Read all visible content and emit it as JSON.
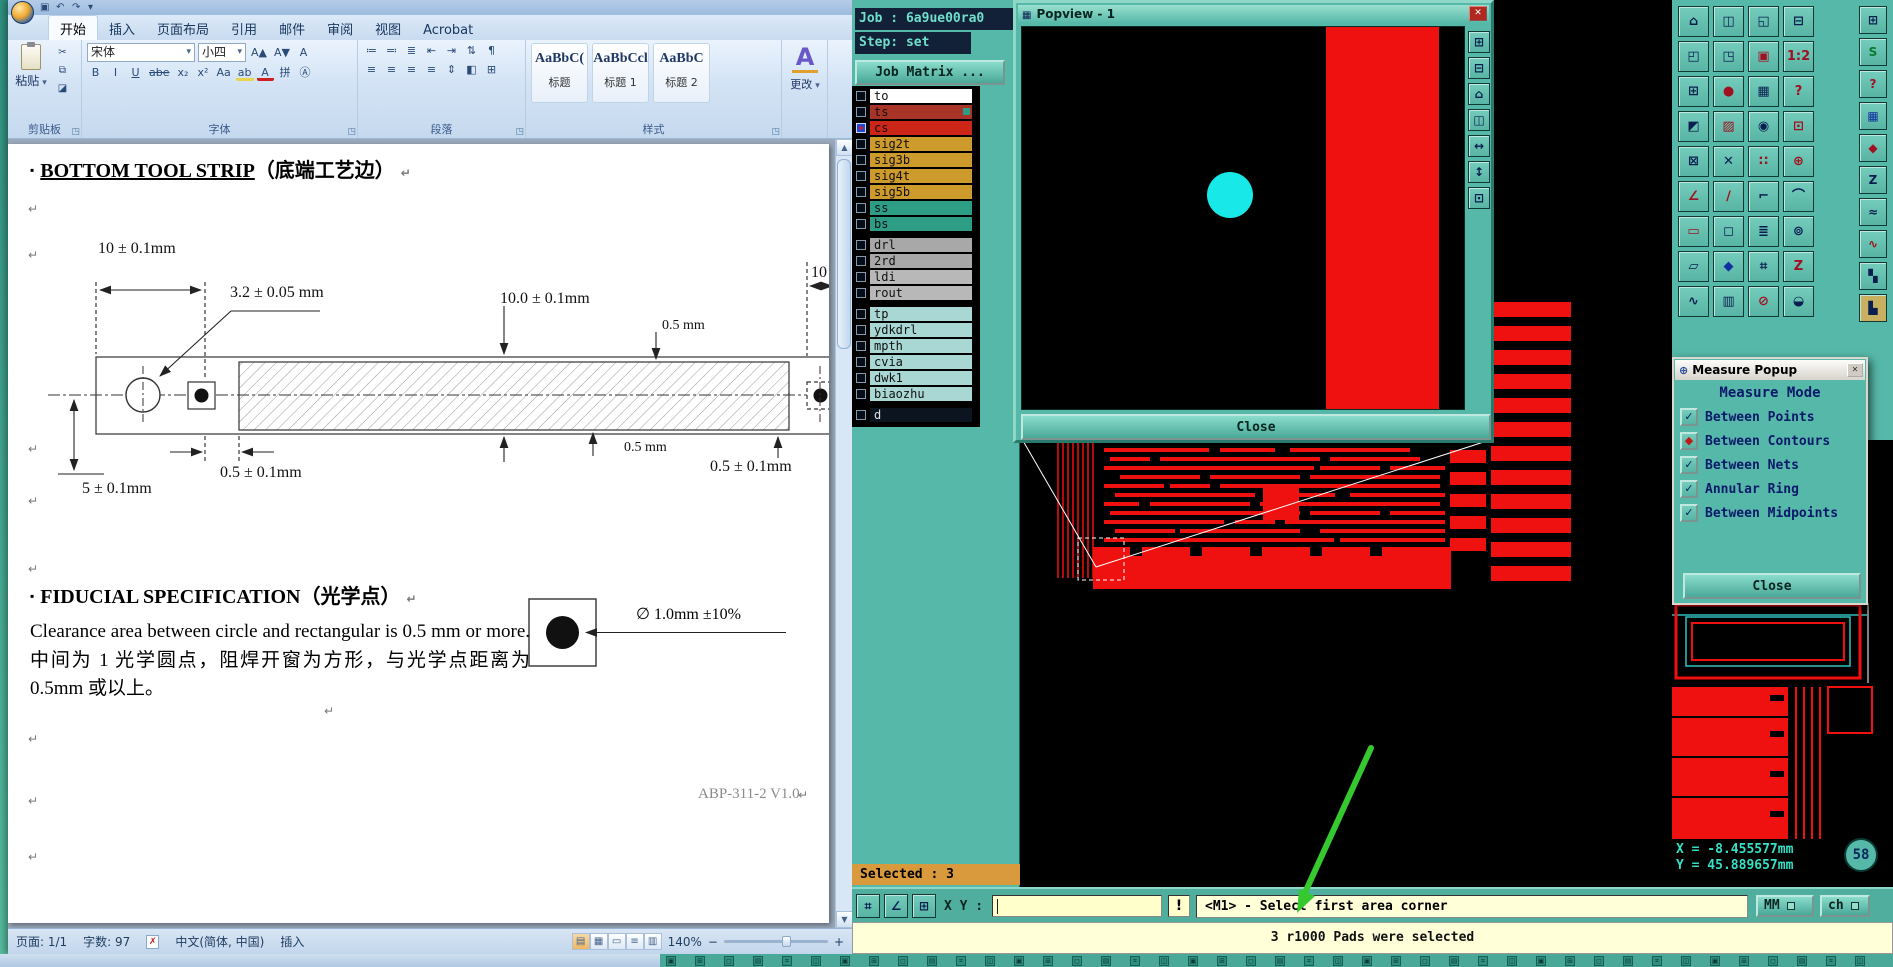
{
  "word": {
    "qat": {
      "save": "▣",
      "undo": "↶",
      "redo": "↷",
      "more": "▾"
    },
    "tabs": [
      {
        "label": "开始",
        "active": true
      },
      {
        "label": "插入"
      },
      {
        "label": "页面布局"
      },
      {
        "label": "引用"
      },
      {
        "label": "邮件"
      },
      {
        "label": "审阅"
      },
      {
        "label": "视图"
      },
      {
        "label": "Acrobat"
      }
    ],
    "ribbon": {
      "paste_label": "粘贴",
      "clip_buttons": [
        {
          "g": "✂"
        },
        {
          "g": "⧉"
        },
        {
          "g": "◪"
        }
      ],
      "clipboard_group": "剪贴板",
      "font_name": "宋体",
      "font_size": "小四",
      "size_buttons": [
        {
          "g": "A▲"
        },
        {
          "g": "A▼"
        },
        {
          "g": "A"
        }
      ],
      "font_buttons": [
        {
          "g": "B"
        },
        {
          "g": "I"
        },
        {
          "g": "U",
          "u": true
        },
        {
          "g": "abe",
          "s": true
        },
        {
          "g": "x₂"
        },
        {
          "g": "x²"
        },
        {
          "g": "Aa"
        },
        {
          "g": "ab",
          "bar": "#e8d44d"
        },
        {
          "g": "A",
          "bar": "#cc2020"
        },
        {
          "g": "拼"
        },
        {
          "g": "Ⓐ"
        }
      ],
      "font_group": "字体",
      "para_row1": [
        {
          "g": "≔"
        },
        {
          "g": "≕"
        },
        {
          "g": "≣"
        },
        {
          "g": "⇤"
        },
        {
          "g": "⇥"
        },
        {
          "g": "⇅"
        },
        {
          "g": "¶"
        }
      ],
      "para_row2": [
        {
          "g": "≡"
        },
        {
          "g": "≡"
        },
        {
          "g": "≡"
        },
        {
          "g": "≡"
        },
        {
          "g": "⇕"
        },
        {
          "g": "◧"
        },
        {
          "g": "⊞"
        }
      ],
      "paragraph_group": "段落",
      "styles": [
        {
          "sample": "AaBbC(",
          "name": "标题"
        },
        {
          "sample": "AaBbCcl",
          "name": "标题 1"
        },
        {
          "sample": "AaBbC",
          "name": "标题 2"
        }
      ],
      "change_icon": "A",
      "change_label": "更改",
      "styles_group": "样式"
    },
    "document": {
      "bullet": "▪",
      "heading1_en": "BOTTOM TOOL STRIP",
      "heading1_cn": "（底端工艺边）",
      "dims": {
        "d1": "10 ± 0.1mm",
        "d2": "3.2 ± 0.05 mm",
        "d3": "10.0 ± 0.1mm",
        "d4": "0.5 mm",
        "d5": "0.5 ± 0.1mm",
        "d6": "0.5 mm",
        "d7": "0.5 ± 0.1mm",
        "d8": "5 ± 0.1mm",
        "d9": "10"
      },
      "heading2_en": "FIDUCIAL SPECIFICATION",
      "heading2_cn": "（光学点）",
      "body_text": "Clearance area between circle and rectangular is 0.5 mm or more. 中间为 1 光学圆点，阻焊开窗为方形，与光学点距离为 0.5mm 或以上。",
      "fiducial_label": "∅ 1.0mm ±10%",
      "doc_number": "ABP-311-2 V1.0",
      "pilcrow": "↵"
    },
    "status": {
      "page": "页面: 1/1",
      "words": "字数: 97",
      "spell": "✗",
      "lang": "中文(简体, 中国)",
      "insert": "插入",
      "view_icons": [
        {
          "g": "▤"
        },
        {
          "g": "▦"
        },
        {
          "g": "▭"
        },
        {
          "g": "≡"
        },
        {
          "g": "▥"
        }
      ],
      "zoom": "140%",
      "zoom_out": "−",
      "zoom_in": "+"
    }
  },
  "cad": {
    "job_label": "Job : 6a9ue00ra0",
    "step_label": "Step: set",
    "matrix_button": "Job Matrix ...",
    "layer_groups": [
      [
        {
          "name": "to",
          "bg": "#ffffff"
        },
        {
          "name": "ts",
          "bg": "#a83428",
          "marker": true
        },
        {
          "name": "cs",
          "bg": "#cc2618",
          "checked": true
        },
        {
          "name": "sig2t",
          "bg": "#cd9a2c"
        },
        {
          "name": "sig3b",
          "bg": "#cd9a2c"
        },
        {
          "name": "sig4t",
          "bg": "#cd9a2c"
        },
        {
          "name": "sig5b",
          "bg": "#cd9a2c"
        },
        {
          "name": "ss",
          "bg": "#2e9d86"
        },
        {
          "name": "bs",
          "bg": "#2e9d86"
        }
      ],
      [
        {
          "name": "drl",
          "bg": "#a8a8a8"
        },
        {
          "name": "2rd",
          "bg": "#a8a8a8"
        },
        {
          "name": "ldi",
          "bg": "#b8b8b8"
        },
        {
          "name": "rout",
          "bg": "#b8b8b8"
        }
      ],
      [
        {
          "name": "tp",
          "bg": "#a9d8d4"
        },
        {
          "name": "ydkdrl",
          "bg": "#a9d8d4"
        },
        {
          "name": "mpth",
          "bg": "#a9d8d4"
        },
        {
          "name": "cvia",
          "bg": "#a9d8d4"
        },
        {
          "name": "dwk1",
          "bg": "#a9d8d4"
        },
        {
          "name": "biaozhu",
          "bg": "#a9d8d4"
        }
      ],
      [
        {
          "name": "d",
          "bg": "#0c1420",
          "fg": "#e0e0e0"
        }
      ]
    ],
    "selected_label": "Selected : 3",
    "popview": {
      "icon": "▦",
      "title": "Popview - 1",
      "close_label": "Close",
      "side_icons": [
        {
          "g": "⊞"
        },
        {
          "g": "⊟"
        },
        {
          "g": "⌂"
        },
        {
          "g": "◫"
        },
        {
          "g": "↔"
        },
        {
          "g": "↕"
        },
        {
          "g": "⊡"
        }
      ]
    },
    "measure": {
      "title": "Measure Popup",
      "title_icon": "⊕",
      "mode_title": "Measure Mode",
      "options": [
        {
          "label": "Between Points",
          "glyph": "✓"
        },
        {
          "label": "Between Contours",
          "glyph": "◆",
          "selected": true
        },
        {
          "label": "Between Nets",
          "glyph": "✓"
        },
        {
          "label": "Annular Ring",
          "glyph": "✓"
        },
        {
          "label": "Between Midpoints",
          "glyph": "✓"
        }
      ],
      "close_label": "Close"
    },
    "coords_x": "X = -8.455577mm",
    "coords_y": "Y = 45.889657mm",
    "command": {
      "left_icons": [
        {
          "g": "⌗"
        },
        {
          "g": "∠"
        },
        {
          "g": "⊞"
        }
      ],
      "xy_label": "X Y :",
      "input_value": "",
      "alert_icon": "!",
      "prompt": "<M1> - Select first area corner",
      "unit": "MM",
      "unit2": "ch"
    },
    "status_message": "3 r1000 Pads were selected",
    "badge": "58",
    "right_toolbar": {
      "grid": [
        {
          "g": "⌂",
          "c": "#0a1e50"
        },
        {
          "g": "◫",
          "c": "#0a1e50"
        },
        {
          "g": "◱",
          "c": "#0a1e50"
        },
        {
          "g": "⊟",
          "c": "#0a1e50"
        },
        {
          "g": "◰",
          "c": "#0a1e50"
        },
        {
          "g": "◳",
          "c": "#0a1e50"
        },
        {
          "g": "▣",
          "c": "#a01020"
        },
        {
          "g": "1:2",
          "c": "#a01020"
        },
        {
          "g": "⊞",
          "c": "#0a1e50"
        },
        {
          "g": "●",
          "c": "#a01020"
        },
        {
          "g": "▦",
          "c": "#0a1e50"
        },
        {
          "g": "?",
          "c": "#a01020"
        },
        {
          "g": "◩",
          "c": "#0a1e50"
        },
        {
          "g": "▨",
          "c": "#a01020"
        },
        {
          "g": "◉",
          "c": "#0a1e50"
        },
        {
          "g": "⊡",
          "c": "#a01020"
        },
        {
          "g": "⊠",
          "c": "#0a1e50"
        },
        {
          "g": "✕",
          "c": "#0a1e50"
        },
        {
          "g": "∷",
          "c": "#a01020"
        },
        {
          "g": "⊕",
          "c": "#a01020"
        },
        {
          "g": "∠",
          "c": "#a01020"
        },
        {
          "g": "∕",
          "c": "#a01020"
        },
        {
          "g": "⌐",
          "c": "#0a1e50"
        },
        {
          "g": "⌒",
          "c": "#0a1e50"
        },
        {
          "g": "▭",
          "c": "#a01020"
        },
        {
          "g": "◻",
          "c": "#0a1e50"
        },
        {
          "g": "≣",
          "c": "#0a1e50"
        },
        {
          "g": "⊚",
          "c": "#0a1e50"
        },
        {
          "g": "▱",
          "c": "#0a1e50"
        },
        {
          "g": "◆",
          "c": "#1030a0"
        },
        {
          "g": "⌗",
          "c": "#0a1e50"
        },
        {
          "g": "Z",
          "c": "#a01020"
        },
        {
          "g": "∿",
          "c": "#0a1e50"
        },
        {
          "g": "▥",
          "c": "#0a1e50"
        },
        {
          "g": "⊘",
          "c": "#a01020"
        },
        {
          "g": "◒",
          "c": "#0a1e50"
        }
      ],
      "col": [
        {
          "g": "⊞",
          "c": "#0a1e50"
        },
        {
          "g": "S",
          "c": "#0a7a30"
        },
        {
          "g": "?",
          "c": "#a01020"
        },
        {
          "g": "▦",
          "c": "#1030a0"
        },
        {
          "g": "◆",
          "c": "#a01020"
        },
        {
          "g": "Z",
          "c": "#0a1e50"
        },
        {
          "g": "≈",
          "c": "#0a1e50"
        },
        {
          "g": "∿",
          "c": "#a01020"
        },
        {
          "g": "▚",
          "c": "#0a1e50"
        },
        {
          "g": "▙",
          "c": "#0a1e50",
          "bg": "#c8b060"
        }
      ]
    },
    "bottom_strip": {
      "count": 42,
      "glyphs": [
        "▣",
        "⊞",
        "◻",
        "▤",
        "⌗",
        "◫"
      ]
    }
  }
}
